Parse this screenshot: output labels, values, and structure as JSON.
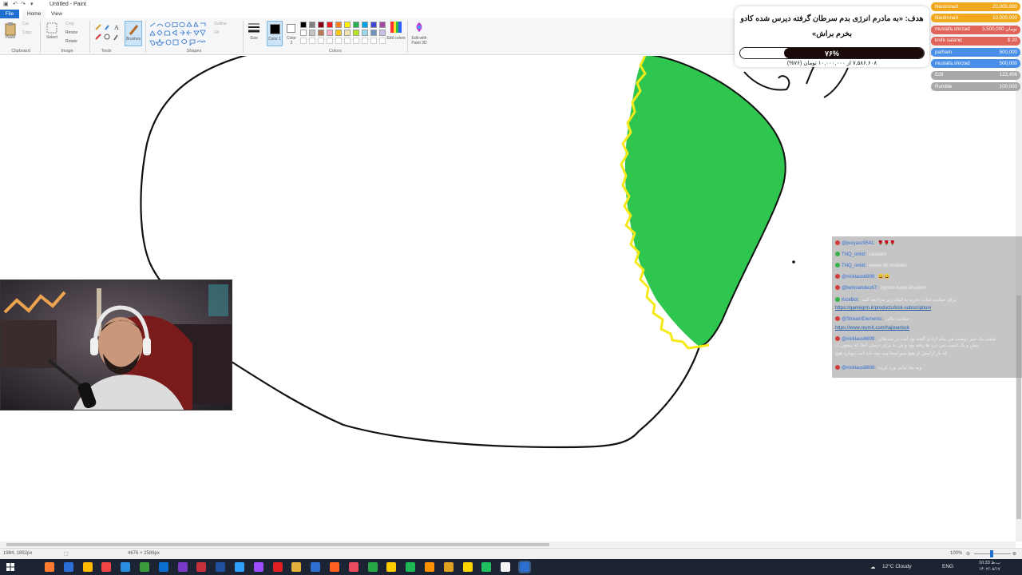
{
  "window": {
    "title": "Untitled - Paint"
  },
  "ribbon": {
    "tabs": [
      "File",
      "Home",
      "View"
    ],
    "clipboard": {
      "paste": "Paste",
      "cut": "Cut",
      "copy": "Copy",
      "label": "Clipboard"
    },
    "image": {
      "select": "Select",
      "crop": "Crop",
      "resize": "Resize",
      "rotate": "Rotate",
      "label": "Image"
    },
    "tools": {
      "brushes": "Brushes",
      "label": "Tools"
    },
    "shapes": {
      "outline": "Outline",
      "fill": "Fill",
      "label": "Shapes"
    },
    "size": "Size",
    "color1": "Color 1",
    "color2": "Color 2",
    "colors_label": "Colors",
    "edit_colors": "Edit colors",
    "edit_3d": "Edit with Paint 3D",
    "palette": [
      "#000000",
      "#7f7f7f",
      "#880015",
      "#ed1c24",
      "#ff7f27",
      "#fff200",
      "#22b14c",
      "#00a2e8",
      "#3f48cc",
      "#a349a4",
      "#ffffff",
      "#c3c3c3",
      "#b97a57",
      "#ffaec9",
      "#ffc90e",
      "#efe4b0",
      "#b5e61d",
      "#99d9ea",
      "#7092be",
      "#c8bfe7"
    ]
  },
  "status": {
    "cursor": "1984, 1892px",
    "dimensions": "4676 × 2586px",
    "zoom": "100%"
  },
  "taskbar": {
    "weather": "12°C  Cloudy",
    "lang": "ENG",
    "time": "10:33 ب.ظ",
    "date": "۱۴۰۲/۰۸/۱۷"
  },
  "overlay": {
    "goal": {
      "title": "هدف: «به مادرم انرژی بدم سرطان گرفته دیرس شده کادو بخرم براش»",
      "percent_label": "۷۶%",
      "progress": 0.76,
      "subtitle": "۷,۵۸۶,۶۰۸ از ۱۰,۰۰۰,۰۰۰ تومان (۷۶%)"
    },
    "donors": [
      {
        "name": "NeutronaX",
        "amount": "20,000,000",
        "color": "#f2a81d"
      },
      {
        "name": "NeutronaX",
        "amount": "10,000,000",
        "color": "#f2a81d"
      },
      {
        "name": "mustafa.shirzad",
        "amount": "تومان 3,500,000",
        "color": "#e0645a"
      },
      {
        "name": "knife satanic",
        "amount": "$ 20",
        "color": "#e0645a"
      },
      {
        "name": "parham",
        "amount": "500,000",
        "color": "#4a8fe7"
      },
      {
        "name": "mustafa.shirzad",
        "amount": "500,000",
        "color": "#4a8fe7"
      },
      {
        "name": "Edii",
        "amount": "123,456",
        "color": "#a8a8a8"
      },
      {
        "name": "Rumble",
        "amount": "100,000",
        "color": "#a8a8a8"
      }
    ],
    "chat": [
      {
        "user": "@puryaxz9541:",
        "text": "🌹🌹🌹",
        "badge": "#d43b3b"
      },
      {
        "user": "TNQ_omid:",
        "text": "salaaam",
        "badge": "#35b24a"
      },
      {
        "user": "TNQ_omid:",
        "text": "eeeee dir residam",
        "badge": "#35b24a"
      },
      {
        "user": "@nicklaus6699:",
        "text": "😀😀",
        "badge": "#d43b3b"
      },
      {
        "user": "@behnamdez67:",
        "text": "2ghoto have afsanev!",
        "badge": "#d43b3b"
      },
      {
        "user": "KickBot:",
        "text": "برای حمایت ساب بخرید به لینک زیر مراجعه کنید",
        "badge": "#35b24a"
      },
      {
        "link": "https://gamegrin.ir/products/kick-subscription/"
      },
      {
        "user": "@StreamElements:",
        "text": "حمایت مالی",
        "badge": "#d43b3b"
      },
      {
        "link": "https://www.reymit.com/hajiwarlock"
      },
      {
        "user": "@nicklaus6699:",
        "text": "هیچی یک چیز دوست من پیام آزادی گفته بود آیت در سرطان",
        "badge": "#d43b3b"
      },
      {
        "text": "بیش و یک آسیب من درد ها رفته بود و ش بد برای درمان انجا که بیچون ک",
        "cont": true
      },
      {
        "text": "که باز آرامش از هیچ شو اینجا سه بچه باید آیت دوباره هیچ",
        "cont": true
      },
      {
        "user": "@nicklaus6699:",
        "text": "وبه ماد بیانی ورد کرده",
        "badge": "#d43b3b"
      }
    ]
  }
}
